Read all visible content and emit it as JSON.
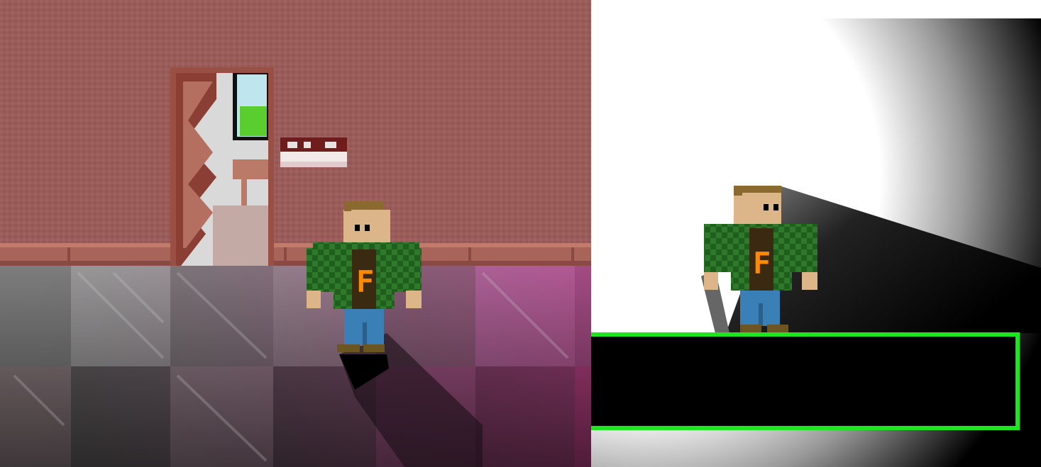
{
  "scene": {
    "left_view": "game-view",
    "right_view": "debug-light-view"
  },
  "character": {
    "shirt_letter": "F"
  },
  "colors": {
    "wall": "#9e5f5b",
    "baseboard": "#b06a5e",
    "door_frame": "#9a4f45",
    "jacket_green": "#2f7a2a",
    "jacket_dark": "#1b5a19",
    "skin": "#dcb588",
    "hair": "#8a6a2e",
    "shirt": "#3a2a12",
    "letter": "#ff8a00",
    "jeans": "#3a7fb5",
    "collision_box": "#1ee61e"
  },
  "icons": [
    "door-icon",
    "wall-sign-icon",
    "player-icon"
  ]
}
